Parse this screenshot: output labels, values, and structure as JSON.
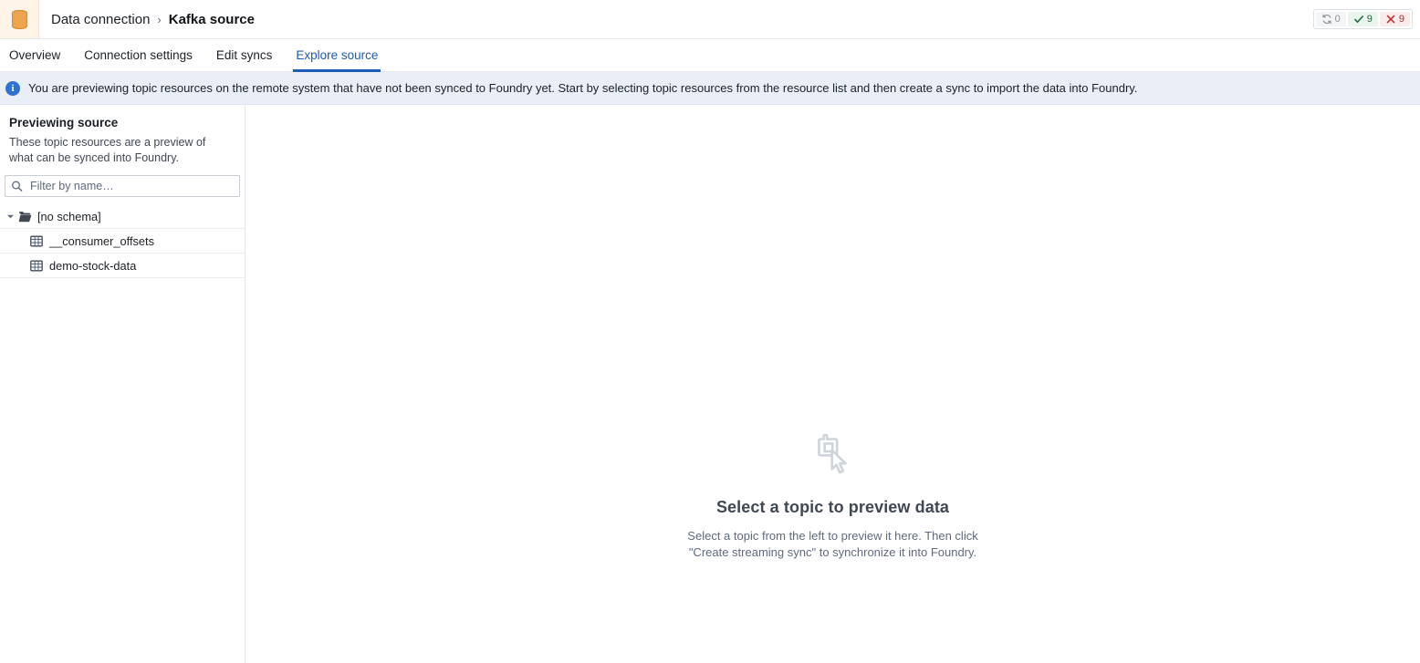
{
  "header": {
    "logo_icon": "database-icon",
    "breadcrumb": {
      "root": "Data connection",
      "separator": "›",
      "current": "Kafka source"
    },
    "status_badges": [
      {
        "icon": "sync-icon",
        "count": "0",
        "style": "neutral"
      },
      {
        "icon": "check-icon",
        "count": "9",
        "style": "success"
      },
      {
        "icon": "cross-icon",
        "count": "9",
        "style": "danger"
      }
    ]
  },
  "tabs": [
    {
      "label": "Overview",
      "active": false
    },
    {
      "label": "Connection settings",
      "active": false
    },
    {
      "label": "Edit syncs",
      "active": false
    },
    {
      "label": "Explore source",
      "active": true
    }
  ],
  "banner": {
    "icon": "info-icon",
    "glyph": "i",
    "text": "You are previewing topic resources on the remote system that have not been synced to Foundry yet. Start by selecting topic resources from the resource list and then create a sync to import the data into Foundry."
  },
  "sidebar": {
    "title": "Previewing source",
    "description": "These topic resources are a preview of what can be synced into Foundry.",
    "filter": {
      "icon": "search-icon",
      "placeholder": "Filter by name…",
      "value": ""
    },
    "tree": [
      {
        "label": "[no schema]",
        "type": "folder",
        "icon": "folder-icon",
        "caret": "chevron-down-icon",
        "expanded": true
      },
      {
        "label": "__consumer_offsets",
        "type": "table",
        "icon": "table-icon"
      },
      {
        "label": "demo-stock-data",
        "type": "table",
        "icon": "table-icon"
      }
    ]
  },
  "main": {
    "empty_state": {
      "icon": "select-cursor-icon",
      "title": "Select a topic to preview data",
      "description": "Select a topic from the left to preview it here. Then click \"Create streaming sync\" to synchronize it into Foundry."
    }
  },
  "colors": {
    "accent": "#1e5bb5",
    "banner_bg": "#e9eef7",
    "info_icon": "#2d72d2",
    "logo_orange": "#e8943a",
    "logo_bg": "#fdf3e7",
    "success": "#1c6b3c",
    "danger": "#a82a2a",
    "muted_text": "#5f6b7c"
  }
}
